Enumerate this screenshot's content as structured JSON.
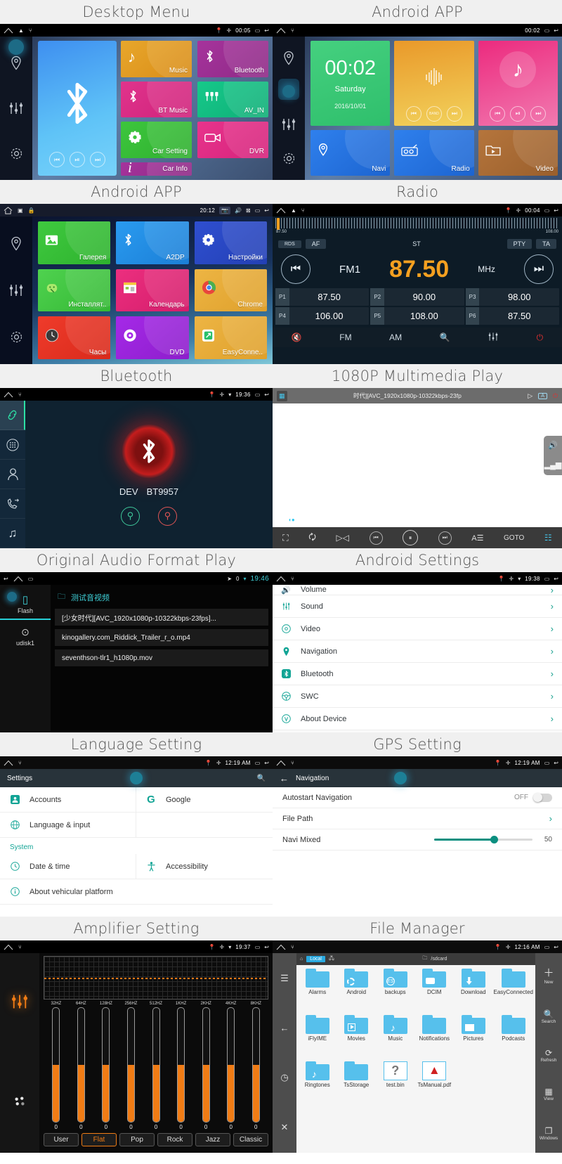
{
  "panels": {
    "desktop_menu": {
      "caption": "Desktop Menu",
      "status": {
        "clock": "00:05"
      },
      "preview_tile": {
        "name": "bluetooth-preview"
      },
      "tiles": [
        {
          "label": "Music",
          "icon": "music-note-icon",
          "color1": "#e8a72c",
          "color2": "#d98c17"
        },
        {
          "label": "Bluetooth",
          "icon": "bluetooth-icon",
          "color1": "#a6339c",
          "color2": "#8e2a86"
        },
        {
          "label": "BT Music",
          "icon": "bt-music-icon",
          "color1": "#e0348c",
          "color2": "#d0227b"
        },
        {
          "label": "AV_IN",
          "icon": "av-in-icon",
          "color1": "#16c98a",
          "color2": "#0fae77"
        },
        {
          "label": "Car Setting",
          "icon": "gear-icon",
          "color1": "#3dc63d",
          "color2": "#2fb02f"
        },
        {
          "label": "DVR",
          "icon": "camcorder-icon",
          "color1": "#e8348c",
          "color2": "#d6237c"
        },
        {
          "label": "Car Info",
          "icon": "info-icon",
          "color1": "#a6339c",
          "color2": "#8e2a86"
        }
      ]
    },
    "android_app_1": {
      "caption": "Android APP",
      "status": {
        "clock": "00:02"
      },
      "clock_widget": {
        "time": "00:02",
        "day": "Saturday",
        "date": "2016/10/01"
      },
      "radio_widget": {
        "band_label": "BAND"
      },
      "widgets_bottom": [
        {
          "label": "Navi",
          "icon": "location-pin-icon",
          "color1": "#2f80ed",
          "color2": "#1c64d0"
        },
        {
          "label": "Radio",
          "icon": "radio-icon",
          "color1": "#2f80ed",
          "color2": "#1c64d0"
        },
        {
          "label": "Video",
          "icon": "video-folder-icon",
          "color1": "#b5753c",
          "color2": "#9a5f2c"
        }
      ]
    },
    "android_app_2": {
      "caption": "Android APP",
      "status": {
        "clock": "20:12"
      },
      "apps": [
        {
          "label": "Галерея",
          "icon": "gallery-icon",
          "color1": "#3fc93f",
          "color2": "#2eb22e"
        },
        {
          "label": "A2DP",
          "icon": "bluetooth-audio-icon",
          "color1": "#2a9bf0",
          "color2": "#1b7ed6"
        },
        {
          "label": "Настройки",
          "icon": "gear-icon",
          "color1": "#2f4fd0",
          "color2": "#2340b5"
        },
        {
          "label": "Инсталлят..",
          "icon": "apk-installer-icon",
          "color1": "#4fd24f",
          "color2": "#35b835"
        },
        {
          "label": "Календарь",
          "icon": "calendar-icon",
          "color1": "#ec2f7f",
          "color2": "#d41d6b"
        },
        {
          "label": "Chrome",
          "icon": "chrome-icon",
          "color1": "#edb544",
          "color2": "#dfa02b"
        },
        {
          "label": "Часы",
          "icon": "clock-icon",
          "color1": "#ef3b2b",
          "color2": "#d92a1b"
        },
        {
          "label": "DVD",
          "icon": "dvd-icon",
          "color1": "#a529e8",
          "color2": "#8d1ecb"
        },
        {
          "label": "EasyConne..",
          "icon": "easyconnected-icon",
          "color1": "#edb544",
          "color2": "#dfa02b"
        }
      ]
    },
    "radio": {
      "caption": "Radio",
      "status": {
        "clock": "00:04"
      },
      "scale_min": "87.50",
      "scale_max": "108.00",
      "chips_left": [
        "RDS",
        "AF"
      ],
      "stereo": "ST",
      "chips_right": [
        "PTY",
        "TA"
      ],
      "band": "FM1",
      "frequency": "87.50",
      "unit": "MHz",
      "presets": [
        {
          "no": "P1",
          "value": "87.50"
        },
        {
          "no": "P2",
          "value": "90.00"
        },
        {
          "no": "P3",
          "value": "98.00"
        },
        {
          "no": "P4",
          "value": "106.00"
        },
        {
          "no": "P5",
          "value": "108.00"
        },
        {
          "no": "P6",
          "value": "87.50"
        }
      ],
      "bottom_bar": [
        "mute-icon",
        "FM",
        "AM",
        "search-icon",
        "equalizer-icon",
        "power-icon"
      ]
    },
    "bluetooth": {
      "caption": "Bluetooth",
      "status": {
        "clock": "19:36"
      },
      "device_prefix": "DEV",
      "device_name": "BT9957",
      "rail_icons": [
        "link-icon",
        "dialpad-icon",
        "contacts-icon",
        "call-log-icon",
        "bt-music-icon"
      ],
      "actions": [
        "connect-icon",
        "disconnect-icon"
      ]
    },
    "multimedia": {
      "caption": "1080P Multimedia Play",
      "title": "时代][AVC_1920x1080p-10322kbps-23fp",
      "top_icons": [
        "grid-icon",
        "play-icon",
        "aspect-icon",
        "power-icon"
      ],
      "side_icons": [
        "volume-icon",
        "equalizer-bars-icon"
      ],
      "controls": [
        "fullscreen-icon",
        "repeat-icon",
        "mirror-icon",
        "prev-icon",
        "pause-icon",
        "next-icon",
        "subtitle-icon",
        "GOTO",
        "playlist-icon"
      ]
    },
    "audio_format": {
      "caption": "Original Audio Format Play",
      "status": {
        "clock": "19:46"
      },
      "sources": [
        "Flash",
        "udisk1"
      ],
      "folder": "测试音视频",
      "files": [
        "[少女时代][AVC_1920x1080p-10322kbps-23fps]...",
        "kinogallery.com_Riddick_Trailer_r_o.mp4",
        "seventhson-tlr1_h1080p.mov"
      ]
    },
    "android_settings": {
      "caption": "Android Settings",
      "status": {
        "clock": "19:38"
      },
      "rows": [
        {
          "label": "Volume",
          "icon": "volume-icon"
        },
        {
          "label": "Sound",
          "icon": "sound-icon"
        },
        {
          "label": "Video",
          "icon": "video-icon"
        },
        {
          "label": "Navigation",
          "icon": "location-pin-icon"
        },
        {
          "label": "Bluetooth",
          "icon": "bluetooth-icon"
        },
        {
          "label": "SWC",
          "icon": "steering-wheel-icon"
        },
        {
          "label": "About Device",
          "icon": "about-icon"
        }
      ]
    },
    "language_setting": {
      "caption": "Language Setting",
      "status": {
        "clock": "12:19 AM"
      },
      "app_title": "Settings",
      "rows": [
        {
          "label": "Accounts",
          "icon": "account-icon"
        },
        {
          "label": "Google",
          "icon": "google-icon"
        },
        {
          "label": "Language & input",
          "icon": "globe-icon"
        }
      ],
      "section": "System",
      "system_rows": [
        {
          "label": "Date & time",
          "icon": "clock-icon"
        },
        {
          "label": "Accessibility",
          "icon": "accessibility-icon"
        },
        {
          "label": "About vehicular platform",
          "icon": "info-icon"
        }
      ]
    },
    "gps_setting": {
      "caption": "GPS Setting",
      "status": {
        "clock": "12:19 AM"
      },
      "app_title": "Navigation",
      "rows": [
        {
          "label": "Autostart Navigation",
          "value": "OFF",
          "type": "toggle"
        },
        {
          "label": "File Path",
          "value": "",
          "type": "chevron"
        },
        {
          "label": "Navi Mixed",
          "value": "50",
          "type": "slider"
        }
      ]
    },
    "amplifier": {
      "caption": "Amplifier Setting",
      "status": {
        "clock": "19:37"
      },
      "bands": [
        {
          "freq": "32HZ",
          "value": "0"
        },
        {
          "freq": "64HZ",
          "value": "0"
        },
        {
          "freq": "128HZ",
          "value": "0"
        },
        {
          "freq": "256HZ",
          "value": "0"
        },
        {
          "freq": "512HZ",
          "value": "0"
        },
        {
          "freq": "1KHZ",
          "value": "0"
        },
        {
          "freq": "2KHZ",
          "value": "0"
        },
        {
          "freq": "4KHZ",
          "value": "0"
        },
        {
          "freq": "8KHZ",
          "value": "0"
        }
      ],
      "presets": [
        "User",
        "Flat",
        "Pop",
        "Rock",
        "Jazz",
        "Classic"
      ],
      "active_preset": "Flat"
    },
    "file_manager": {
      "caption": "File Manager",
      "status": {
        "clock": "12:16 AM"
      },
      "tab": "Local",
      "path": "/sdcard",
      "items": [
        {
          "label": "Alarms",
          "icon": "folder-icon"
        },
        {
          "label": "Android",
          "icon": "folder-gear-icon"
        },
        {
          "label": "backups",
          "icon": "folder-es-icon"
        },
        {
          "label": "DCIM",
          "icon": "folder-camera-icon"
        },
        {
          "label": "Download",
          "icon": "folder-download-icon"
        },
        {
          "label": "EasyConnected",
          "icon": "folder-icon"
        },
        {
          "label": "iFlyIME",
          "icon": "folder-icon"
        },
        {
          "label": "Movies",
          "icon": "folder-video-icon"
        },
        {
          "label": "Music",
          "icon": "folder-music-icon"
        },
        {
          "label": "Notifications",
          "icon": "folder-icon"
        },
        {
          "label": "Pictures",
          "icon": "folder-image-icon"
        },
        {
          "label": "Podcasts",
          "icon": "folder-icon"
        },
        {
          "label": "Ringtones",
          "icon": "folder-music-icon"
        },
        {
          "label": "TsStorage",
          "icon": "folder-icon"
        },
        {
          "label": "test.bin",
          "icon": "unknown-file-icon"
        },
        {
          "label": "TsManual.pdf",
          "icon": "pdf-file-icon"
        }
      ],
      "side_actions": [
        {
          "label": "New",
          "icon": "plus-icon"
        },
        {
          "label": "Search",
          "icon": "search-icon"
        },
        {
          "label": "Refresh",
          "icon": "refresh-icon"
        },
        {
          "label": "View",
          "icon": "view-grid-icon"
        },
        {
          "label": "Windows",
          "icon": "windows-icon"
        }
      ]
    }
  },
  "colors": {
    "accent_teal": "#12a495",
    "accent_orange": "#f07c15",
    "accent_blue": "#56c0ec"
  }
}
